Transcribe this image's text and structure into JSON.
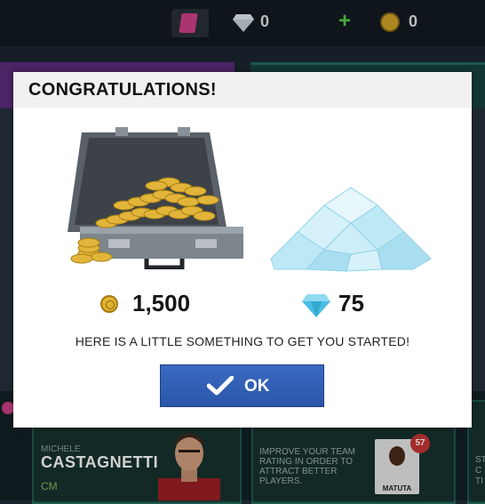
{
  "topbar": {
    "gems_count": "0",
    "coins_count": "0",
    "plus_symbol": "+"
  },
  "background": {
    "player_first_name": "MICHELE",
    "player_last_name": "CASTAGNETTI",
    "player_position": "CM",
    "improve_text": "IMPROVE YOUR TEAM RATING IN ORDER TO ATTRACT BETTER PLAYERS.",
    "card_player_name": "MATUTA",
    "card_rating": "57",
    "right_edge_text": "ST\nC\nTI"
  },
  "modal": {
    "title": "CONGRATULATIONS!",
    "coins_reward": "1,500",
    "gems_reward": "75",
    "message": "HERE IS A LITTLE SOMETHING TO GET YOU STARTED!",
    "ok_label": "OK"
  },
  "colors": {
    "ok_button": "#2f5db4",
    "coin": "#e0b22e",
    "gem": "#5fc8e8"
  }
}
